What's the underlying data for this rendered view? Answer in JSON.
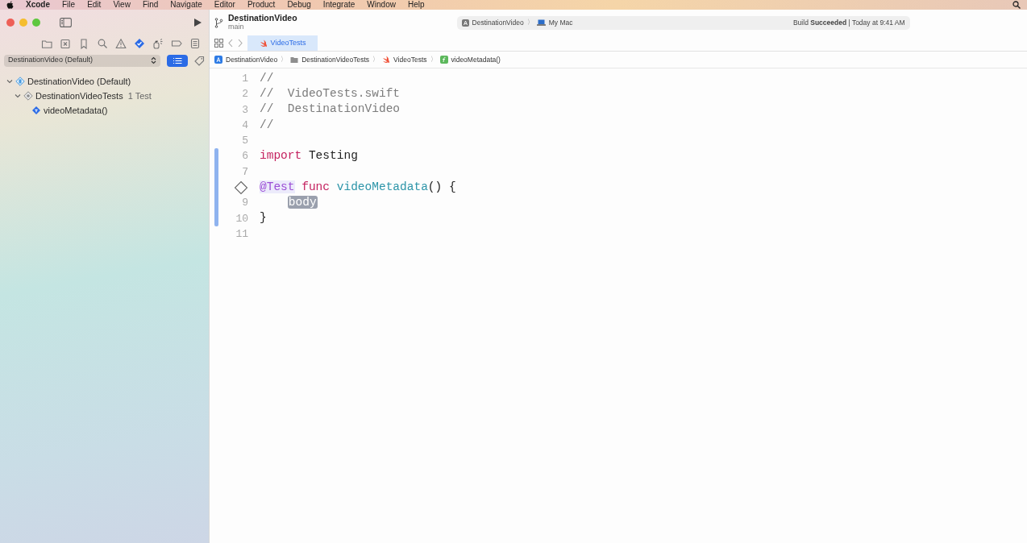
{
  "menu_bar": {
    "app": "Xcode",
    "items": [
      "File",
      "Edit",
      "View",
      "Find",
      "Navigate",
      "Editor",
      "Product",
      "Debug",
      "Integrate",
      "Window",
      "Help"
    ]
  },
  "toolbar": {
    "project": "DestinationVideo",
    "branch": "main",
    "activity": {
      "scheme": "DestinationVideo",
      "separator": "〉",
      "destination": "My Mac",
      "status": "Build **Succeeded** | Today at 9:41 AM"
    }
  },
  "navigator_tabs": [
    {
      "selected": false
    },
    {
      "selected": false
    },
    {
      "selected": false
    },
    {
      "selected": false
    },
    {
      "selected": false
    },
    {
      "selected": true
    },
    {
      "selected": false
    },
    {
      "selected": false
    },
    {
      "selected": false
    }
  ],
  "scheme_filter": {
    "value": "DestinationVideo (Default)",
    "filter_on": true
  },
  "test_tree": [
    {
      "kind": "plan",
      "name": "DestinationVideo (Default)",
      "expanded": true,
      "children": [
        {
          "kind": "target",
          "name": "DestinationVideoTests",
          "count": "1 Test",
          "expanded": true,
          "children": [
            {
              "kind": "test",
              "name": "videoMetadata()"
            }
          ]
        }
      ]
    }
  ],
  "editor_tabs": [
    {
      "label": "VideoTests",
      "selected": true
    }
  ],
  "breadcrumbs": [
    {
      "kind": "app",
      "label": "DestinationVideo"
    },
    {
      "kind": "folder",
      "label": "DestinationVideoTests"
    },
    {
      "kind": "swift",
      "label": "VideoTests"
    },
    {
      "kind": "function",
      "label": "videoMetadata()"
    }
  ],
  "code_lines": [
    {
      "number": "1",
      "changed": false,
      "tokens": [
        {
          "kind": "comment",
          "text": "//"
        }
      ]
    },
    {
      "number": "2",
      "changed": false,
      "tokens": [
        {
          "kind": "comment",
          "text": "//  VideoTests.swift"
        }
      ]
    },
    {
      "number": "3",
      "changed": false,
      "tokens": [
        {
          "kind": "comment",
          "text": "//  DestinationVideo"
        }
      ]
    },
    {
      "number": "4",
      "changed": false,
      "tokens": [
        {
          "kind": "comment",
          "text": "//"
        }
      ]
    },
    {
      "number": "5",
      "changed": false
    },
    {
      "number": "6",
      "changed": true,
      "tokens": [
        {
          "kind": "keyword",
          "text": "import"
        },
        {
          "kind": "plain",
          "text": " Testing"
        }
      ]
    },
    {
      "number": "7",
      "changed": true
    },
    {
      "test_marker": true,
      "changed": true,
      "tokens": [
        {
          "kind": "attribute",
          "text": "@Test"
        },
        {
          "kind": "keyword",
          "text": " func"
        },
        {
          "kind": "function",
          "text": " videoMetadata"
        },
        {
          "kind": "plain",
          "text": "() {"
        }
      ]
    },
    {
      "number": "9",
      "changed": true,
      "indented": true,
      "tokens": [
        {
          "kind": "placeholder",
          "text": "body"
        }
      ]
    },
    {
      "number": "10",
      "changed": true,
      "tokens": [
        {
          "kind": "plain",
          "text": "}"
        }
      ]
    },
    {
      "number": "11",
      "changed": false
    }
  ]
}
